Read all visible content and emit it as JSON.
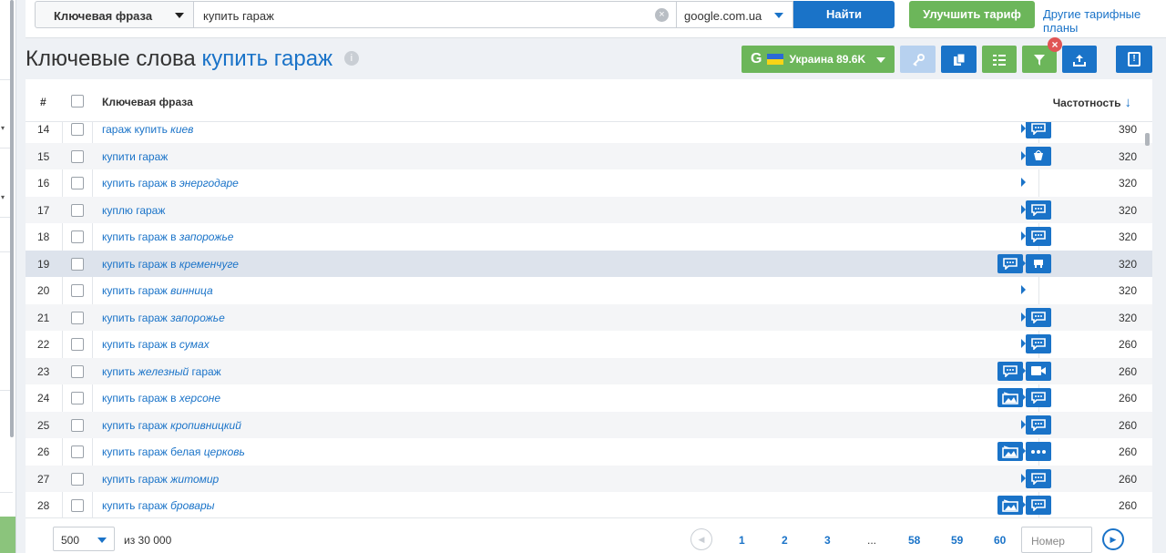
{
  "search": {
    "type_label": "Ключевая фраза",
    "query": "купить гараж",
    "engine": "google.com.ua",
    "find_label": "Найти",
    "upgrade_label": "Улучшить тариф",
    "plans_link": "Другие тарифные планы"
  },
  "header": {
    "title_prefix": "Ключевые слова",
    "title_keyword": "купить гараж",
    "region_label": "Украина 89.6K",
    "google_letter": "G"
  },
  "table": {
    "col_num": "#",
    "col_keyword": "Ключевая фраза",
    "col_freq": "Частотность",
    "rows": [
      {
        "n": "14",
        "a": "гараж купить ",
        "b": "киев",
        "c": "",
        "f": "390",
        "icons": [
          "chat-icon"
        ]
      },
      {
        "n": "15",
        "a": "купити гараж",
        "b": "",
        "c": "",
        "f": "320",
        "icons": [
          "basket-icon"
        ]
      },
      {
        "n": "16",
        "a": "купить гараж в ",
        "b": "энергодаре",
        "c": "",
        "f": "320",
        "icons": []
      },
      {
        "n": "17",
        "a": "куплю гараж",
        "b": "",
        "c": "",
        "f": "320",
        "icons": [
          "chat-icon"
        ]
      },
      {
        "n": "18",
        "a": "купить гараж в ",
        "b": "запорожье",
        "c": "",
        "f": "320",
        "icons": [
          "chat-icon"
        ]
      },
      {
        "n": "19",
        "a": "купить гараж в ",
        "b": "кременчуге",
        "c": "",
        "f": "320",
        "icons": [
          "chat-icon",
          "store-icon"
        ]
      },
      {
        "n": "20",
        "a": "купить гараж ",
        "b": "винница",
        "c": "",
        "f": "320",
        "icons": []
      },
      {
        "n": "21",
        "a": "купить гараж ",
        "b": "запорожье",
        "c": "",
        "f": "320",
        "icons": [
          "chat-icon"
        ]
      },
      {
        "n": "22",
        "a": "купить гараж в ",
        "b": "сумах",
        "c": "",
        "f": "260",
        "icons": [
          "chat-icon"
        ]
      },
      {
        "n": "23",
        "a": "купить ",
        "b": "железный",
        "c": " гараж",
        "f": "260",
        "icons": [
          "chat-icon",
          "video-icon"
        ]
      },
      {
        "n": "24",
        "a": "купить гараж в ",
        "b": "херсоне",
        "c": "",
        "f": "260",
        "icons": [
          "image-icon",
          "chat-icon"
        ]
      },
      {
        "n": "25",
        "a": "купить гараж ",
        "b": "кропивницкий",
        "c": "",
        "f": "260",
        "icons": [
          "chat-icon"
        ]
      },
      {
        "n": "26",
        "a": "купить гараж белая ",
        "b": "церковь",
        "c": "",
        "f": "260",
        "icons": [
          "image-icon",
          "more-icon"
        ]
      },
      {
        "n": "27",
        "a": "купить гараж ",
        "b": "житомир",
        "c": "",
        "f": "260",
        "icons": [
          "chat-icon"
        ]
      },
      {
        "n": "28",
        "a": "купить гараж ",
        "b": "бровары",
        "c": "",
        "f": "260",
        "icons": [
          "image-icon",
          "chat-icon"
        ]
      }
    ]
  },
  "pagination": {
    "per_page": "500",
    "of_total": "из 30 000",
    "pages": [
      "1",
      "2",
      "3",
      "...",
      "58",
      "59",
      "60"
    ],
    "current": "1",
    "page_input_placeholder": "Номер"
  },
  "colors": {
    "accent_blue": "#1a73c8",
    "accent_green": "#6cb65a",
    "highlight_row": "#dde3ec"
  }
}
